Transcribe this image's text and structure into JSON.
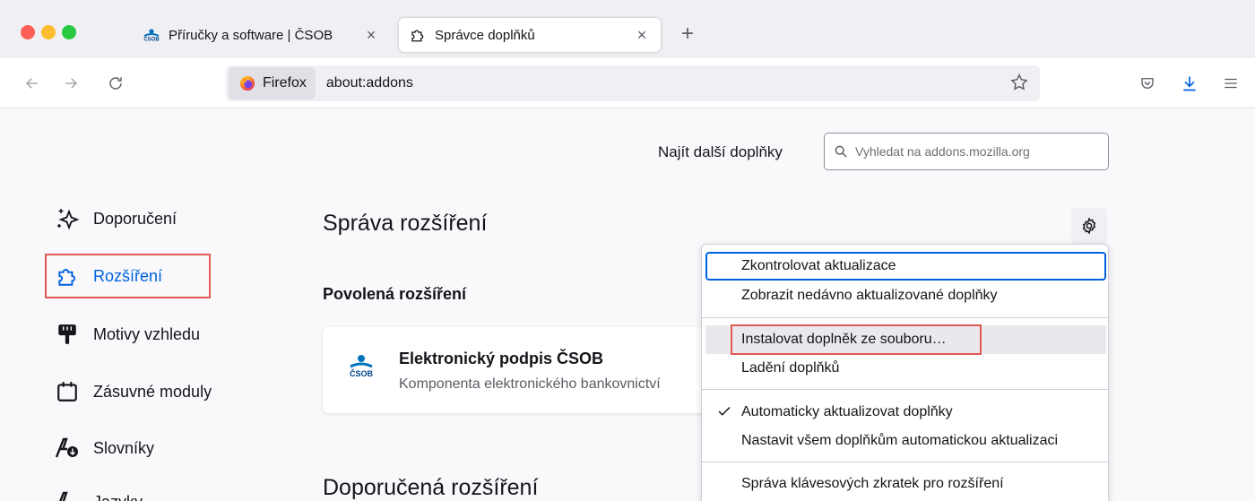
{
  "tabs": [
    {
      "title": "Příručky a software | ČSOB",
      "close": "×",
      "favicon": "csob-logo"
    },
    {
      "title": "Správce doplňků",
      "close": "×",
      "favicon": "puzzle-icon"
    }
  ],
  "new_tab": "+",
  "navbar": {
    "identity_label": "Firefox",
    "url": "about:addons"
  },
  "find_more": {
    "label": "Najít další doplňky",
    "placeholder": "Vyhledat na addons.mozilla.org"
  },
  "sidebar": {
    "items": [
      {
        "label": "Doporučení",
        "icon": "sparkle-icon"
      },
      {
        "label": "Rozšíření",
        "icon": "puzzle-icon"
      },
      {
        "label": "Motivy vzhledu",
        "icon": "brush-icon"
      },
      {
        "label": "Zásuvné moduly",
        "icon": "plugin-icon"
      },
      {
        "label": "Slovníky",
        "icon": "dictionary-icon"
      },
      {
        "label": "Jazyky",
        "icon": "language-icon"
      }
    ]
  },
  "main": {
    "title": "Správa rozšíření",
    "enabled_heading": "Povolená rozšíření",
    "extension": {
      "name": "Elektronický podpis ČSOB",
      "description": "Komponenta elektronického bankovnictví"
    },
    "recommended_heading": "Doporučená rozšíření"
  },
  "menu": {
    "items": [
      {
        "label": "Zkontrolovat aktualizace"
      },
      {
        "label": "Zobrazit nedávno aktualizované doplňky"
      },
      {
        "label": "Instalovat doplněk ze souboru…"
      },
      {
        "label": "Ladění doplňků"
      },
      {
        "label": "Automaticky aktualizovat doplňky",
        "checked": true
      },
      {
        "label": "Nastavit všem doplňkům automatickou aktualizaci"
      },
      {
        "label": "Správa klávesových zkratek pro rozšíření"
      }
    ]
  },
  "colors": {
    "accent": "#0061e0",
    "highlight_box": "#e05a53"
  }
}
